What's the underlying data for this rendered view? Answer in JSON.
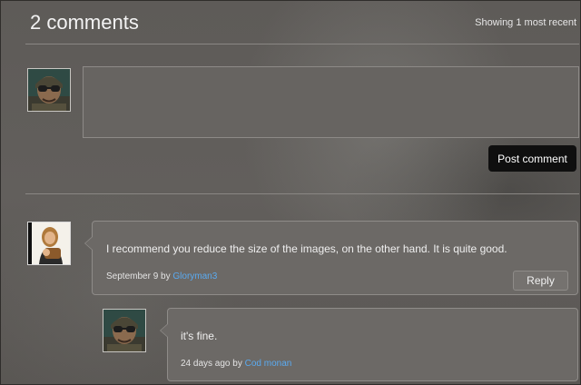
{
  "header": {
    "title": "2 comments",
    "showing": "Showing 1 most recent"
  },
  "composer": {
    "text": "",
    "post_button": "Post comment"
  },
  "comments": [
    {
      "text": "I recommend you reduce the size of the images, on the other hand. It is quite good.",
      "date": "September 9",
      "by": "by",
      "author": "Gloryman3",
      "reply_label": "Reply",
      "avatar_icon": "woman-holding-object-avatar-icon"
    },
    {
      "text": "it's fine.",
      "date": "24 days ago",
      "by": "by",
      "author": "Cod monan",
      "avatar_icon": "soldier-with-goggles-avatar-icon"
    }
  ],
  "current_user": {
    "avatar_icon": "soldier-with-goggles-avatar-icon"
  },
  "colors": {
    "link": "#5aaaf0",
    "button_bg": "#0f0f0f",
    "panel_bg": "#6c6966"
  }
}
